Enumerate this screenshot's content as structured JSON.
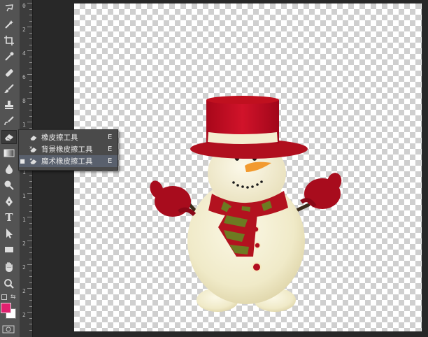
{
  "app": {
    "colors": {
      "foreground": "#e0206f",
      "background": "#ffffff",
      "panel": "#535353",
      "selection": "#59606d"
    }
  },
  "toolbar": {
    "tools": [
      {
        "id": "lasso",
        "icon": "lasso-icon"
      },
      {
        "id": "quick-select",
        "icon": "magic-wand-icon"
      },
      {
        "id": "crop",
        "icon": "crop-icon"
      },
      {
        "id": "eyedropper",
        "icon": "eyedropper-icon"
      },
      {
        "id": "healing",
        "icon": "bandage-icon"
      },
      {
        "id": "brush",
        "icon": "brush-icon"
      },
      {
        "id": "stamp",
        "icon": "stamp-icon"
      },
      {
        "id": "history-brush",
        "icon": "history-brush-icon"
      },
      {
        "id": "eraser",
        "icon": "eraser-icon"
      },
      {
        "id": "gradient",
        "icon": "gradient-icon"
      },
      {
        "id": "blur",
        "icon": "drop-icon"
      },
      {
        "id": "dodge",
        "icon": "dodge-icon"
      },
      {
        "id": "pen",
        "icon": "pen-icon"
      },
      {
        "id": "type",
        "icon": "type-icon"
      },
      {
        "id": "path-select",
        "icon": "arrow-icon"
      },
      {
        "id": "shape",
        "icon": "rectangle-icon"
      },
      {
        "id": "hand",
        "icon": "hand-icon"
      },
      {
        "id": "zoom",
        "icon": "zoom-icon"
      }
    ],
    "type_tool_label": "T"
  },
  "flyout": {
    "items": [
      {
        "label": "橡皮擦工具",
        "shortcut": "E",
        "selected": false,
        "icon": "eraser-icon"
      },
      {
        "label": "背景橡皮擦工具",
        "shortcut": "E",
        "selected": false,
        "icon": "background-eraser-icon"
      },
      {
        "label": "魔术橡皮擦工具",
        "shortcut": "E",
        "selected": true,
        "icon": "magic-eraser-icon"
      }
    ],
    "bullet": "■"
  },
  "ruler": {
    "labels": [
      "0",
      "2",
      "4",
      "6",
      "8",
      "1",
      "1",
      "1",
      "1",
      "1",
      "2",
      "2",
      "2",
      "2"
    ]
  }
}
